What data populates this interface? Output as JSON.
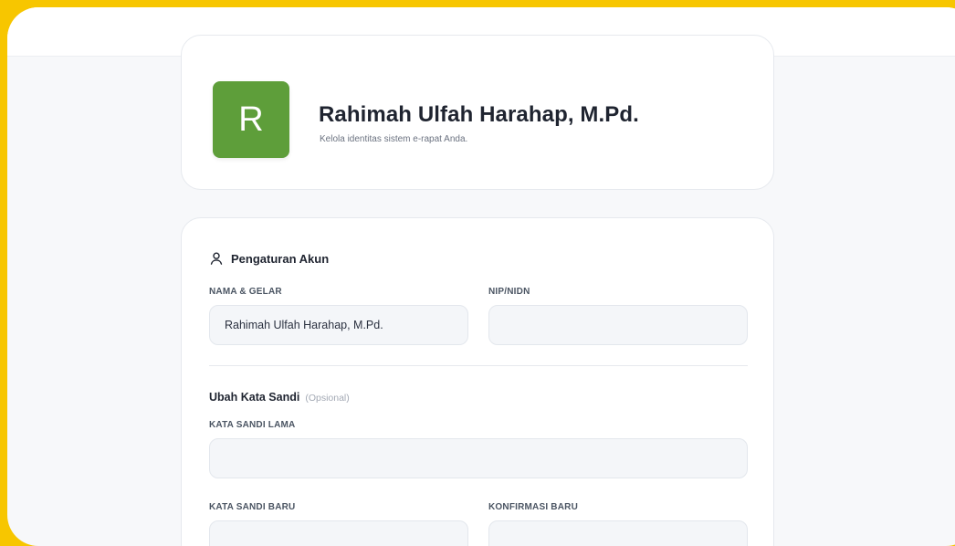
{
  "profile": {
    "avatar_initial": "R",
    "name": "Rahimah Ulfah Harahap, M.Pd.",
    "subtitle": "Kelola identitas sistem e-rapat Anda."
  },
  "account": {
    "section_title": "Pengaturan Akun",
    "section_icon": "user-icon",
    "name_label": "NAMA & GELAR",
    "name_value": "Rahimah Ulfah Harahap, M.Pd.",
    "nip_label": "NIP/NIDN",
    "nip_value": ""
  },
  "password": {
    "title": "Ubah Kata Sandi",
    "optional_note": "(Opsional)",
    "old_label": "KATA SANDI LAMA",
    "new_label": "KATA SANDI BARU",
    "confirm_label": "KONFIRMASI BARU"
  },
  "colors": {
    "frame_background": "#F7C600",
    "avatar": "#5E9E3A",
    "page_background": "#F7F8FA"
  }
}
